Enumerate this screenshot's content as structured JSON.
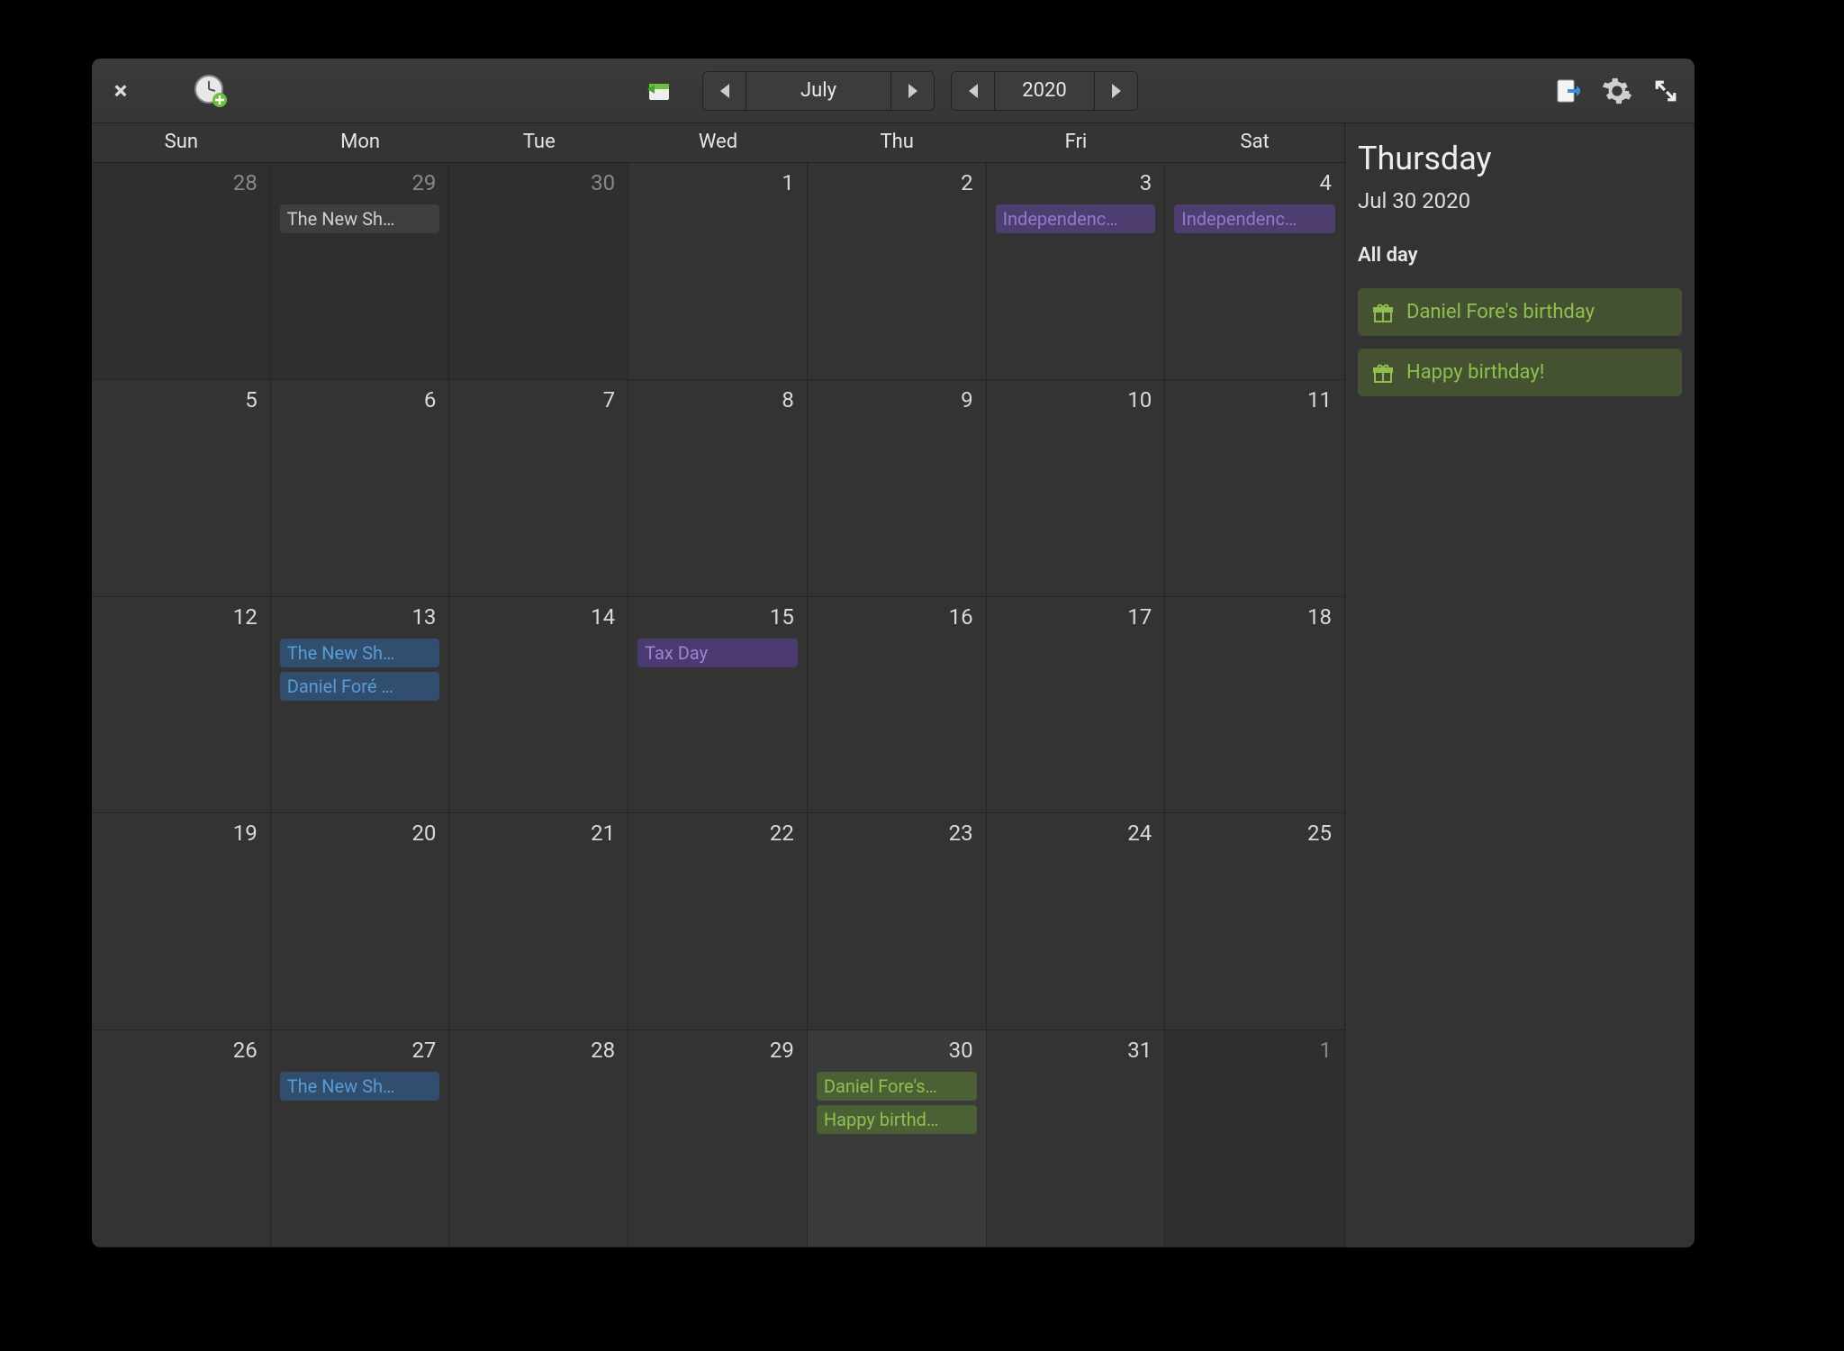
{
  "toolbar": {
    "month": "July",
    "year": "2020"
  },
  "dow": [
    "Sun",
    "Mon",
    "Tue",
    "Wed",
    "Thu",
    "Fri",
    "Sat"
  ],
  "weeks": [
    [
      {
        "n": "28",
        "dim": true,
        "events": []
      },
      {
        "n": "29",
        "dim": true,
        "events": [
          {
            "t": "The New Sh…",
            "c": "plain"
          }
        ]
      },
      {
        "n": "30",
        "dim": true,
        "events": []
      },
      {
        "n": "1",
        "events": []
      },
      {
        "n": "2",
        "events": []
      },
      {
        "n": "3",
        "events": [
          {
            "t": "Independenc…",
            "c": "purple"
          }
        ]
      },
      {
        "n": "4",
        "events": [
          {
            "t": "Independenc…",
            "c": "purple"
          }
        ]
      }
    ],
    [
      {
        "n": "5",
        "events": []
      },
      {
        "n": "6",
        "events": []
      },
      {
        "n": "7",
        "events": []
      },
      {
        "n": "8",
        "events": []
      },
      {
        "n": "9",
        "events": []
      },
      {
        "n": "10",
        "events": []
      },
      {
        "n": "11",
        "events": []
      }
    ],
    [
      {
        "n": "12",
        "events": []
      },
      {
        "n": "13",
        "events": [
          {
            "t": "The New Sh…",
            "c": "blue"
          },
          {
            "t": "Daniel Foré …",
            "c": "blue"
          }
        ]
      },
      {
        "n": "14",
        "events": []
      },
      {
        "n": "15",
        "events": [
          {
            "t": "Tax Day",
            "c": "purple2"
          }
        ]
      },
      {
        "n": "16",
        "events": []
      },
      {
        "n": "17",
        "events": []
      },
      {
        "n": "18",
        "events": []
      }
    ],
    [
      {
        "n": "19",
        "events": []
      },
      {
        "n": "20",
        "events": []
      },
      {
        "n": "21",
        "events": []
      },
      {
        "n": "22",
        "events": []
      },
      {
        "n": "23",
        "events": []
      },
      {
        "n": "24",
        "events": []
      },
      {
        "n": "25",
        "events": []
      }
    ],
    [
      {
        "n": "26",
        "events": []
      },
      {
        "n": "27",
        "events": [
          {
            "t": "The New Sh…",
            "c": "blue"
          }
        ]
      },
      {
        "n": "28",
        "events": []
      },
      {
        "n": "29",
        "events": []
      },
      {
        "n": "30",
        "selected": true,
        "events": [
          {
            "t": "Daniel Fore's…",
            "c": "green"
          },
          {
            "t": "Happy birthd…",
            "c": "green"
          }
        ]
      },
      {
        "n": "31",
        "events": []
      },
      {
        "n": "1",
        "dim": true,
        "events": []
      }
    ]
  ],
  "sidebar": {
    "title": "Thursday",
    "date": "Jul 30 2020",
    "section": "All day",
    "events": [
      {
        "t": "Daniel Fore's birthday"
      },
      {
        "t": "Happy birthday!"
      }
    ]
  }
}
